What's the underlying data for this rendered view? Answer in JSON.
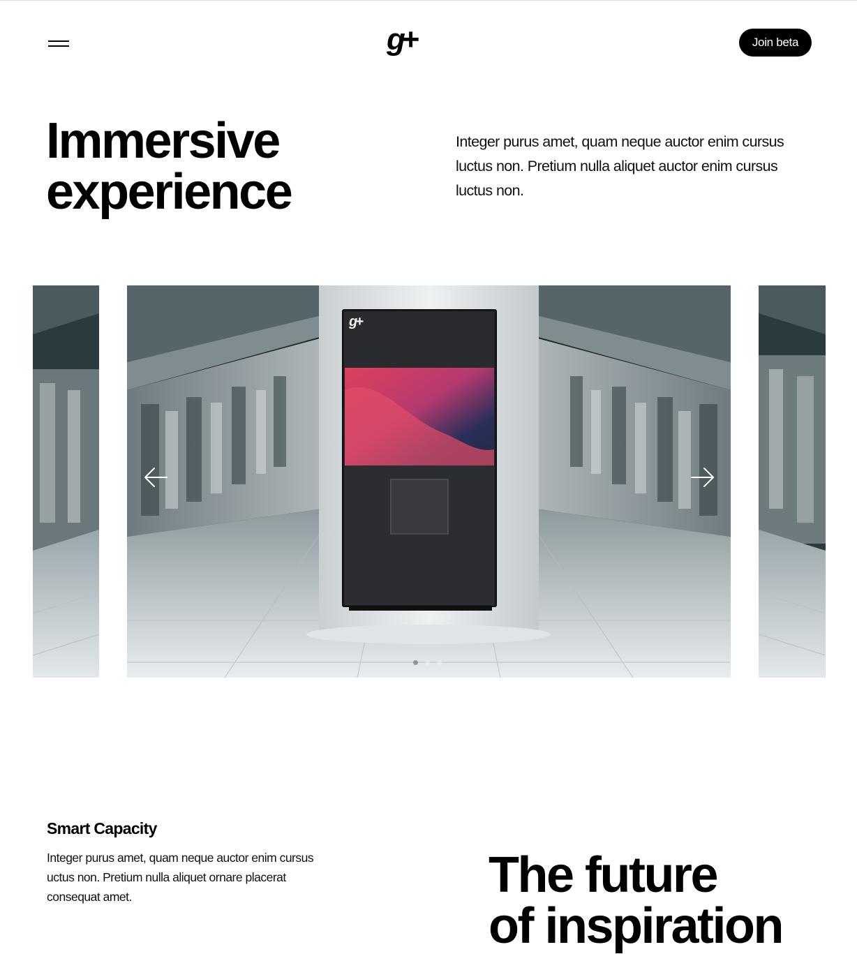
{
  "header": {
    "menu_icon": "hamburger-menu-icon",
    "logo_text": "g+",
    "join_label": "Join beta"
  },
  "hero": {
    "title_line1": "Immersive",
    "title_line2": "experience",
    "text": "Integer purus amet, quam neque auctor enim cursus luctus non. Pretium nulla aliquet auctor enim cursus luctus non."
  },
  "carousel": {
    "prev_icon": "arrow-left-icon",
    "next_icon": "arrow-right-icon",
    "slides": 3,
    "active_slide": 1
  },
  "feature": {
    "title": "Smart Capacity",
    "text": "Integer purus amet, quam neque auctor enim cursus uctus non. Pretium nulla aliquet ornare placerat consequat amet."
  },
  "future": {
    "line1": "The future",
    "line2": "of inspiration"
  },
  "colors": {
    "brand": "#000000",
    "background": "#ffffff",
    "button_text": "#ffffff"
  }
}
